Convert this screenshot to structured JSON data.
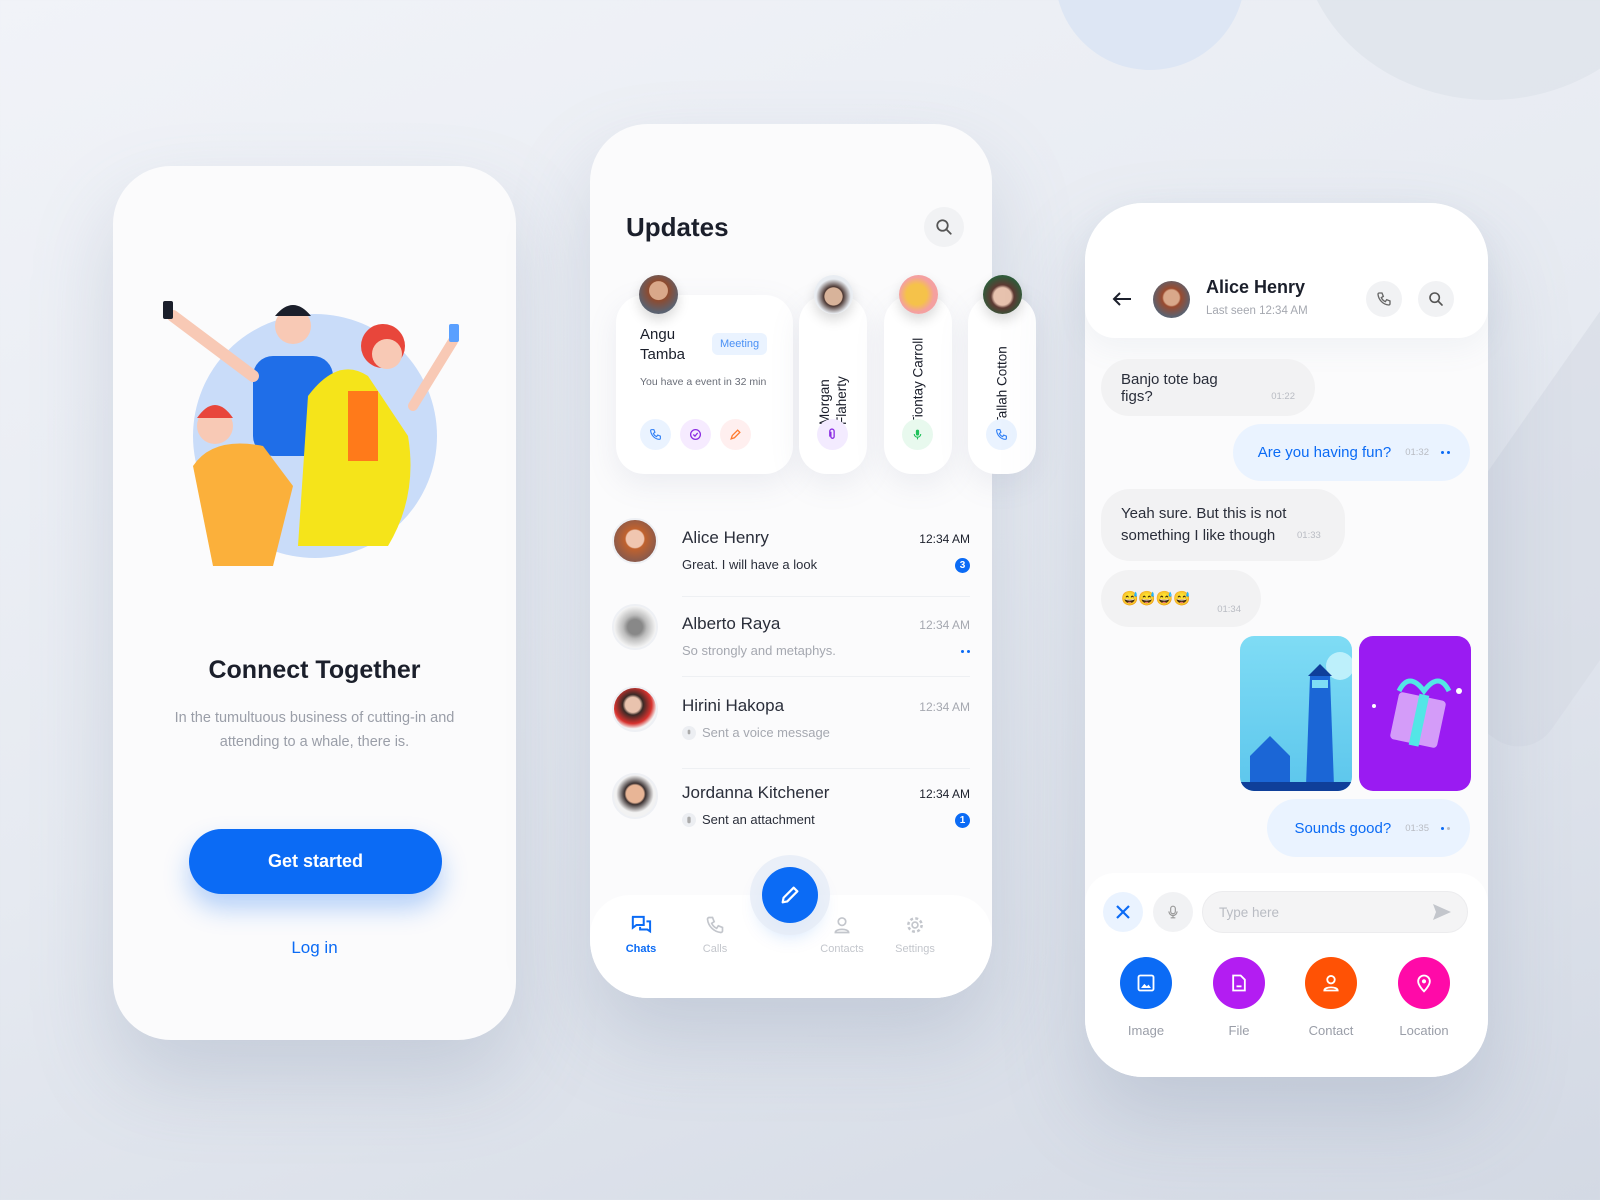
{
  "colors": {
    "accent": "#0b6bf5",
    "purple": "#b31df2",
    "orange": "#ff5205",
    "pink": "#ff0aa8",
    "green": "#1fc15a"
  },
  "onboarding": {
    "title": "Connect Together",
    "description": "In the tumultuous business of cutting-in and attending to a whale, there is.",
    "primary_button": "Get started",
    "secondary_link": "Log in"
  },
  "updates": {
    "title": "Updates",
    "search_icon": "search-icon",
    "featured": {
      "first_name": "Angu",
      "last_name": "Tamba",
      "tag": "Meeting",
      "text": "You have a event in 32 min",
      "actions": [
        "phone-icon",
        "check-circle-icon",
        "pencil-icon"
      ]
    },
    "stories": [
      {
        "name": "Morgan Flaherty",
        "action": "paperclip-icon"
      },
      {
        "name": "Tiontay Carroll",
        "action": "microphone-icon"
      },
      {
        "name": "Tallah Cotton",
        "action": "phone-icon"
      }
    ],
    "chats": [
      {
        "name": "Alice Henry",
        "time": "12:34 AM",
        "message": "Great. I will have a look",
        "unread": "3"
      },
      {
        "name": "Alberto Raya",
        "time": "12:34 AM",
        "message": "So strongly and metaphys.",
        "status": "typing-dots"
      },
      {
        "name": "Hirini Hakopa",
        "time": "12:34 AM",
        "message": "Sent a voice message",
        "icon": "microphone-icon"
      },
      {
        "name": "Jordanna Kitchener",
        "time": "12:34 AM",
        "message": "Sent an attachment",
        "icon": "paperclip-icon",
        "unread": "1"
      }
    ],
    "nav": [
      {
        "label": "Chats",
        "active": true
      },
      {
        "label": "Calls"
      },
      {
        "label": "Contacts"
      },
      {
        "label": "Settings"
      }
    ],
    "fab_icon": "pencil-icon"
  },
  "chat": {
    "name": "Alice Henry",
    "status": "Last seen 12:34 AM",
    "messages": [
      {
        "dir": "in",
        "text": "Banjo tote bag figs?",
        "time": "01:22"
      },
      {
        "dir": "out",
        "text": "Are you having fun?",
        "time": "01:32"
      },
      {
        "dir": "in",
        "text": "Yeah sure. But this is not something I like though",
        "time": "01:33"
      },
      {
        "dir": "in",
        "text": "😅😅😅😅",
        "time": "01:34"
      },
      {
        "dir": "out",
        "images": [
          "lighthouse",
          "gift"
        ]
      },
      {
        "dir": "out",
        "text": "Sounds good?",
        "time": "01:35"
      }
    ],
    "input_placeholder": "Type here",
    "attachments": [
      {
        "label": "Image",
        "icon": "image-icon"
      },
      {
        "label": "File",
        "icon": "file-icon"
      },
      {
        "label": "Contact",
        "icon": "user-icon"
      },
      {
        "label": "Location",
        "icon": "location-pin-icon"
      }
    ]
  }
}
